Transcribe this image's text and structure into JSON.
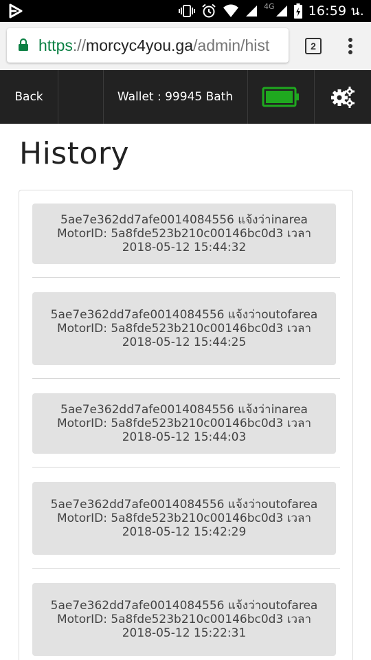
{
  "status_bar": {
    "network_label": "4G",
    "time": "16:59 น."
  },
  "browser": {
    "url_scheme": "https",
    "url_separator": "://",
    "url_host": "morcyc4you.ga",
    "url_path": "/admin/hist",
    "tab_count": "2"
  },
  "navbar": {
    "back_label": "Back",
    "wallet_label": "Wallet : 99945 Bath",
    "battery_color": "#1fa91f"
  },
  "page": {
    "title": "History"
  },
  "history": [
    {
      "text": "5ae7e362dd7afe0014084556 แจ้งว่าinarea MotorID: 5a8fde523b210c00146bc0d3 เวลา 2018-05-12 15:44:32"
    },
    {
      "text": "5ae7e362dd7afe0014084556 แจ้งว่าoutofarea MotorID: 5a8fde523b210c00146bc0d3 เวลา 2018-05-12 15:44:25"
    },
    {
      "text": "5ae7e362dd7afe0014084556 แจ้งว่าinarea MotorID: 5a8fde523b210c00146bc0d3 เวลา 2018-05-12 15:44:03"
    },
    {
      "text": "5ae7e362dd7afe0014084556 แจ้งว่าoutofarea MotorID: 5a8fde523b210c00146bc0d3 เวลา 2018-05-12 15:42:29"
    },
    {
      "text": "5ae7e362dd7afe0014084556 แจ้งว่าoutofarea MotorID: 5a8fde523b210c00146bc0d3 เวลา 2018-05-12 15:22:31"
    }
  ]
}
